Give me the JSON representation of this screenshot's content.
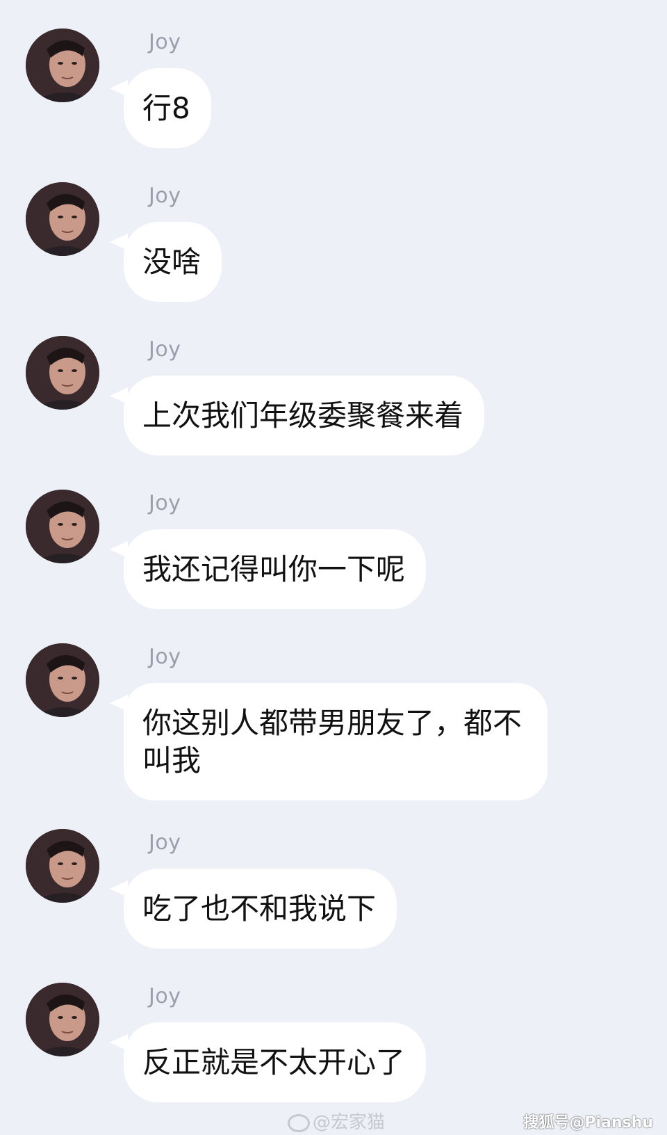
{
  "messages": [
    {
      "sender": "Joy",
      "text": "行8"
    },
    {
      "sender": "Joy",
      "text": "没啥"
    },
    {
      "sender": "Joy",
      "text": "上次我们年级委聚餐来着"
    },
    {
      "sender": "Joy",
      "text": "我还记得叫你一下呢"
    },
    {
      "sender": "Joy",
      "text": "你这别人都带男朋友了，都不叫我"
    },
    {
      "sender": "Joy",
      "text": "吃了也不和我说下"
    },
    {
      "sender": "Joy",
      "text": "反正就是不太开心了"
    }
  ],
  "watermarks": {
    "weibo": "@宏家猫",
    "sohu": "搜狐号@Pianshu"
  }
}
